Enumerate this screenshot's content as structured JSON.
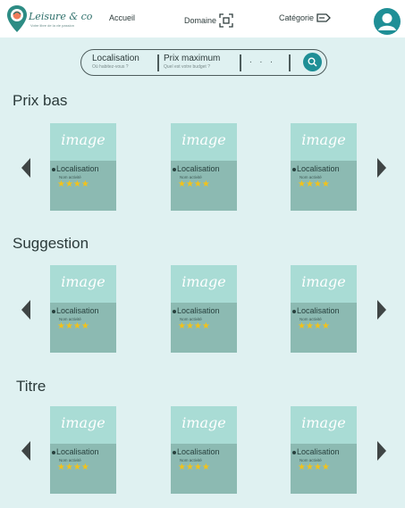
{
  "header": {
    "logo": {
      "name": "Leisure & co",
      "tagline": "Votre libre de la vie passion"
    },
    "nav": [
      {
        "label": "Accueil",
        "icon": ""
      },
      {
        "label": "Domaine",
        "icon": "domain-icon"
      },
      {
        "label": "Catégorie",
        "icon": "tag-icon"
      }
    ],
    "avatar_icon": "user-avatar-icon"
  },
  "search": {
    "location": {
      "title": "Localisation",
      "subtitle": "Où habitez-vous ?"
    },
    "price": {
      "title": "Prix maximum",
      "subtitle": "Quel est votre budget ?"
    },
    "more": ". . .",
    "button_icon": "search-icon"
  },
  "card_template": {
    "image_text": "image",
    "location": "Localisation",
    "activity": "Nom activité",
    "rating": 4,
    "stars": "★★★★"
  },
  "sections": [
    {
      "title": "Prix bas"
    },
    {
      "title": "Suggestion"
    },
    {
      "title": "Titre"
    }
  ],
  "colors": {
    "background": "#dff1f1",
    "accent": "#1f8f96",
    "card_image": "#a9dcd5",
    "card_body": "#8cbab2",
    "star": "#f2c21a"
  }
}
